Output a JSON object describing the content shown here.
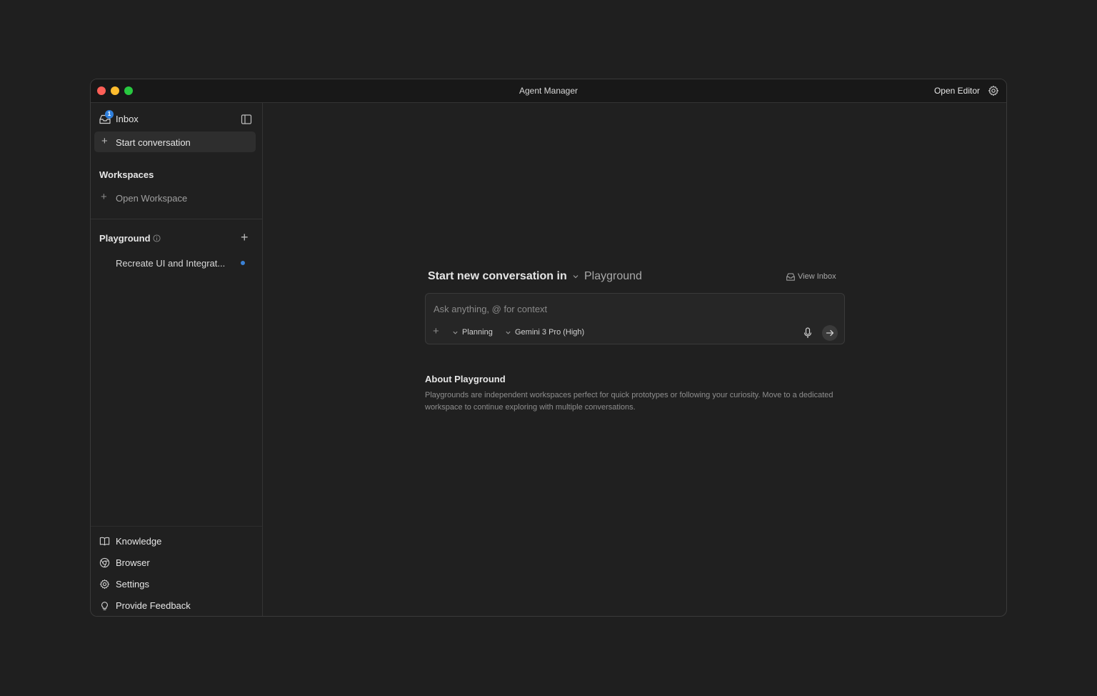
{
  "window": {
    "title": "Agent Manager",
    "open_editor_label": "Open Editor"
  },
  "sidebar": {
    "inbox_label": "Inbox",
    "inbox_badge": "1",
    "start_conversation_label": "Start conversation",
    "workspaces_title": "Workspaces",
    "open_workspace_label": "Open Workspace",
    "playground_title": "Playground",
    "conversations": [
      {
        "label": "Recreate UI and Integrat...",
        "unread": true
      }
    ],
    "bottom_nav": [
      {
        "label": "Knowledge",
        "icon": "book-icon"
      },
      {
        "label": "Browser",
        "icon": "chrome-icon"
      },
      {
        "label": "Settings",
        "icon": "gear-icon"
      },
      {
        "label": "Provide Feedback",
        "icon": "lightbulb-icon"
      }
    ]
  },
  "main": {
    "heading": "Start new conversation in",
    "workspace_selected": "Playground",
    "view_inbox_label": "View Inbox",
    "input_placeholder": "Ask anything, @ for context",
    "mode_selected": "Planning",
    "model_selected": "Gemini 3 Pro (High)",
    "about_title": "About Playground",
    "about_text": "Playgrounds are independent workspaces perfect for quick prototypes or following your curiosity. Move to a dedicated workspace to continue exploring with multiple conversations."
  },
  "colors": {
    "background": "#1f1f1f",
    "window": "#202020",
    "accent": "#2f7fdc",
    "unread_dot": "#3b82d6"
  }
}
